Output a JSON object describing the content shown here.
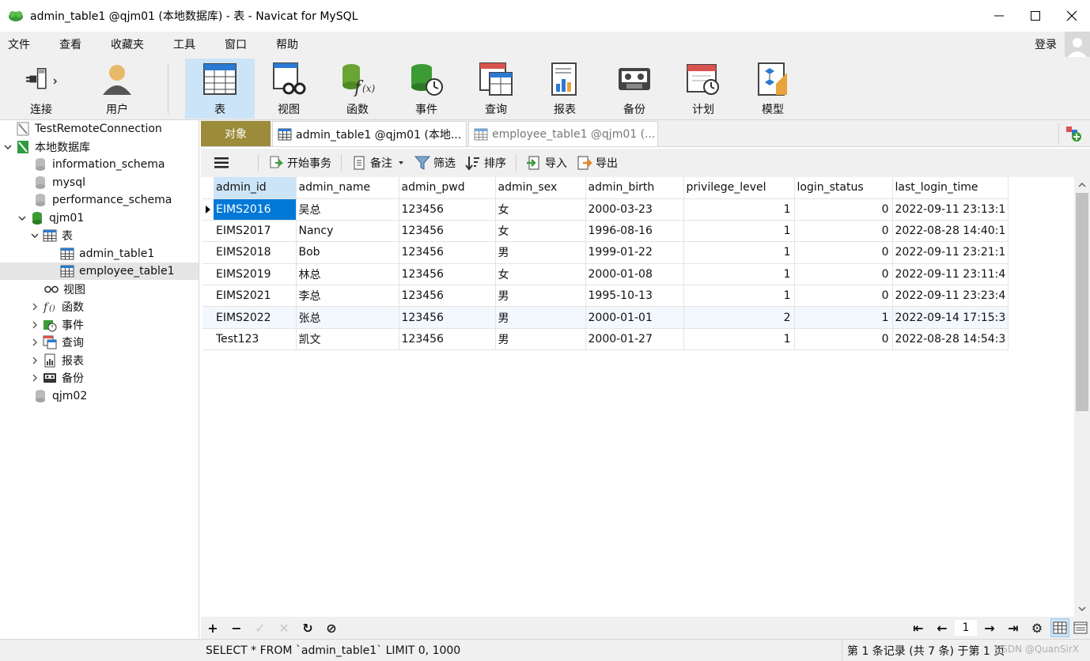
{
  "window": {
    "title": "admin_table1 @qjm01 (本地数据库) - 表 - Navicat for MySQL"
  },
  "menu": [
    "文件",
    "查看",
    "收藏夹",
    "工具",
    "窗口",
    "帮助"
  ],
  "account": {
    "login_label": "登录"
  },
  "toolbar": [
    {
      "label": "连接",
      "icon": "plug-icon"
    },
    {
      "label": "用户",
      "icon": "user-icon"
    },
    {
      "label": "表",
      "icon": "table-icon",
      "active": true
    },
    {
      "label": "视图",
      "icon": "view-icon"
    },
    {
      "label": "函数",
      "icon": "function-icon"
    },
    {
      "label": "事件",
      "icon": "event-icon"
    },
    {
      "label": "查询",
      "icon": "query-icon"
    },
    {
      "label": "报表",
      "icon": "report-icon"
    },
    {
      "label": "备份",
      "icon": "backup-icon"
    },
    {
      "label": "计划",
      "icon": "schedule-icon"
    },
    {
      "label": "模型",
      "icon": "model-icon"
    }
  ],
  "tree": [
    {
      "label": "TestRemoteConnection",
      "level": 0
    },
    {
      "label": "本地数据库",
      "level": 0,
      "expanded": true
    },
    {
      "label": "information_schema",
      "level": 1
    },
    {
      "label": "mysql",
      "level": 1
    },
    {
      "label": "performance_schema",
      "level": 1
    },
    {
      "label": "qjm01",
      "level": 1,
      "expanded": true
    },
    {
      "label": "表",
      "level": 2,
      "expanded": true
    },
    {
      "label": "admin_table1",
      "level": 3
    },
    {
      "label": "employee_table1",
      "level": 3,
      "selected": true
    },
    {
      "label": "视图",
      "level": 2
    },
    {
      "label": "函数",
      "level": 2
    },
    {
      "label": "事件",
      "level": 2
    },
    {
      "label": "查询",
      "level": 2
    },
    {
      "label": "报表",
      "level": 2
    },
    {
      "label": "备份",
      "level": 2
    },
    {
      "label": "qjm02",
      "level": 1
    }
  ],
  "tabs": {
    "objects": "对象",
    "tab1": "admin_table1 @qjm01 (本地...",
    "tab2": "employee_table1 @qjm01 (..."
  },
  "gridbar": {
    "begin_transaction": "开始事务",
    "memo": "备注",
    "filter": "筛选",
    "sort": "排序",
    "import": "导入",
    "export": "导出"
  },
  "table": {
    "columns": [
      "admin_id",
      "admin_name",
      "admin_pwd",
      "admin_sex",
      "admin_birth",
      "privilege_level",
      "login_status",
      "last_login_time"
    ],
    "rows": [
      [
        "EIMS2016",
        "吴总",
        "123456",
        "女",
        "2000-03-23",
        "1",
        "0",
        "2022-09-11 23:13:1"
      ],
      [
        "EIMS2017",
        "Nancy",
        "123456",
        "女",
        "1996-08-16",
        "1",
        "0",
        "2022-08-28 14:40:1"
      ],
      [
        "EIMS2018",
        "Bob",
        "123456",
        "男",
        "1999-01-22",
        "1",
        "0",
        "2022-09-11 23:21:1"
      ],
      [
        "EIMS2019",
        "林总",
        "123456",
        "女",
        "2000-01-08",
        "1",
        "0",
        "2022-09-11 23:11:4"
      ],
      [
        "EIMS2021",
        "李总",
        "123456",
        "男",
        "1995-10-13",
        "1",
        "0",
        "2022-09-11 23:23:4"
      ],
      [
        "EIMS2022",
        "张总",
        "123456",
        "男",
        "2000-01-01",
        "2",
        "1",
        "2022-09-14 17:15:3"
      ],
      [
        "Test123",
        "凯文",
        "123456",
        "男",
        "2000-01-27",
        "1",
        "0",
        "2022-08-28 14:54:3"
      ]
    ]
  },
  "pager": {
    "page": "1"
  },
  "status": {
    "sql": "SELECT * FROM `admin_table1` LIMIT 0, 1000",
    "records": "第 1 条记录 (共 7 条) 于第 1 页",
    "watermark": "CSDN @QuanSirX"
  }
}
